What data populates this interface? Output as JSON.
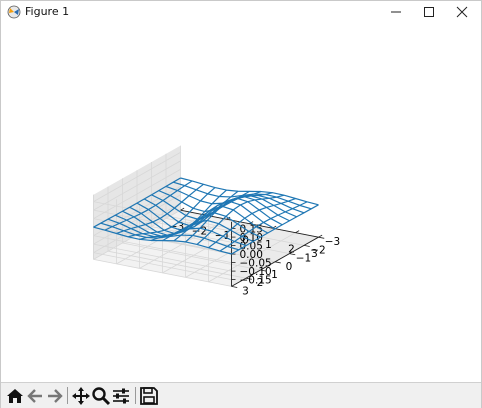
{
  "window": {
    "title": "Figure 1",
    "controls": [
      "minimize",
      "maximize",
      "close"
    ]
  },
  "toolbar": {
    "buttons": [
      {
        "name": "home",
        "icon": "home-icon"
      },
      {
        "name": "back",
        "icon": "arrow-left-icon"
      },
      {
        "name": "forward",
        "icon": "arrow-right-icon"
      },
      {
        "name": "pan",
        "icon": "move-icon"
      },
      {
        "name": "zoom",
        "icon": "magnifier-icon"
      },
      {
        "name": "configure-subplots",
        "icon": "sliders-icon"
      },
      {
        "name": "save",
        "icon": "save-icon"
      }
    ]
  },
  "chart_data": {
    "type": "wireframe",
    "function_form": "z = 0.15 * sin(x) * exp(-(x^2 + y^2)/4) style surface (peak ~0.15, trough ~-0.15)",
    "x_range": [
      -3,
      3
    ],
    "y_range": [
      -3,
      3
    ],
    "z_range": [
      -0.15,
      0.15
    ],
    "grid": true,
    "color": "#1f77b4",
    "x_ticks": [
      "−3",
      "−2",
      "−1",
      "0",
      "1",
      "2",
      "3"
    ],
    "y_ticks": [
      "−3",
      "−2",
      "−1",
      "0",
      "1",
      "2",
      "3"
    ],
    "z_ticks": [
      "−0.15",
      "−0.10",
      "−0.05",
      "0.00",
      "0.05",
      "0.10",
      "0.15"
    ]
  }
}
